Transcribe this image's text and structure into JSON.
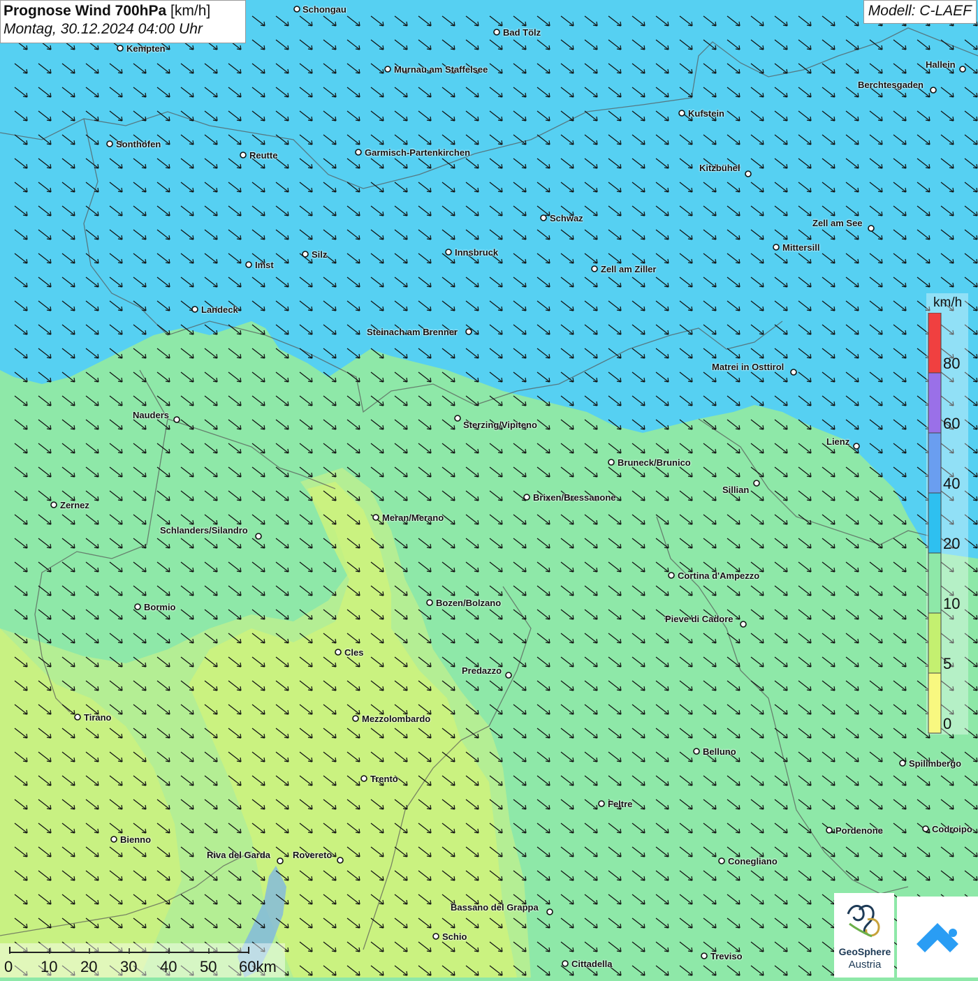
{
  "title": {
    "bold": "Prognose Wind 700hPa",
    "unit": " [km/h]",
    "date": "Montag, 30.12.2024 04:00 Uhr"
  },
  "model": "Modell: C-LAEF",
  "cities": [
    {
      "name": "Schongau"
    },
    {
      "name": "Bad Tölz"
    },
    {
      "name": "Kempten"
    },
    {
      "name": "Murnau am Staffelsee"
    },
    {
      "name": "Hallein"
    },
    {
      "name": "Berchtesgaden"
    },
    {
      "name": "Kufstein"
    },
    {
      "name": "Sonthofen"
    },
    {
      "name": "Reutte"
    },
    {
      "name": "Garmisch-Partenkirchen"
    },
    {
      "name": "Kitzbühel"
    },
    {
      "name": "Schwaz"
    },
    {
      "name": "Zell am See"
    },
    {
      "name": "Mittersill"
    },
    {
      "name": "Innsbruck"
    },
    {
      "name": "Silz"
    },
    {
      "name": "Imst"
    },
    {
      "name": "Zell am Ziller"
    },
    {
      "name": "Landeck"
    },
    {
      "name": "Steinach am Brenner"
    },
    {
      "name": "Matrei in Osttirol"
    },
    {
      "name": "Nauders"
    },
    {
      "name": "Sterzing/Vipiteno"
    },
    {
      "name": "Lienz"
    },
    {
      "name": "Bruneck/Brunico"
    },
    {
      "name": "Sillian"
    },
    {
      "name": "Brixen/Bressanone"
    },
    {
      "name": "Zernez"
    },
    {
      "name": "Meran/Merano"
    },
    {
      "name": "Schlanders/Silandro"
    },
    {
      "name": "Cortina d'Ampezzo"
    },
    {
      "name": "Bozen/Bolzano"
    },
    {
      "name": "Bormio"
    },
    {
      "name": "Pieve di Cadore"
    },
    {
      "name": "Cles"
    },
    {
      "name": "Predazzo"
    },
    {
      "name": "Tirano"
    },
    {
      "name": "Mezzolombardo"
    },
    {
      "name": "Belluno"
    },
    {
      "name": "Spilimbergo"
    },
    {
      "name": "Trento"
    },
    {
      "name": "Feltre"
    },
    {
      "name": "Pordenone"
    },
    {
      "name": "Codroipo"
    },
    {
      "name": "Bienno"
    },
    {
      "name": "Riva del Garda"
    },
    {
      "name": "Rovereto"
    },
    {
      "name": "Conegliano"
    },
    {
      "name": "Bassano del Grappa"
    },
    {
      "name": "Schio"
    },
    {
      "name": "Treviso"
    },
    {
      "name": "Cittadella"
    }
  ],
  "legend": {
    "unit": "km/h",
    "labels": [
      "80",
      "60",
      "40",
      "20",
      "10",
      "5",
      "0"
    ],
    "colors": [
      "#f04040",
      "#9a70e8",
      "#6a9ef0",
      "#2ec0f0",
      "#8ee8a8",
      "#c4f070",
      "#f8f880"
    ]
  },
  "scalebar": {
    "labels": [
      "0",
      "10",
      "20",
      "30",
      "40",
      "50",
      "60km"
    ]
  },
  "logos": {
    "geosphere_line1": "GeoSphere",
    "geosphere_line2": "Austria"
  },
  "colors": {
    "blue_zone": "#56d0f2",
    "green_zone": "#8ee8a8",
    "light_green_zone": "#b4ee94",
    "yellow_green_zone": "#d0f27a"
  }
}
